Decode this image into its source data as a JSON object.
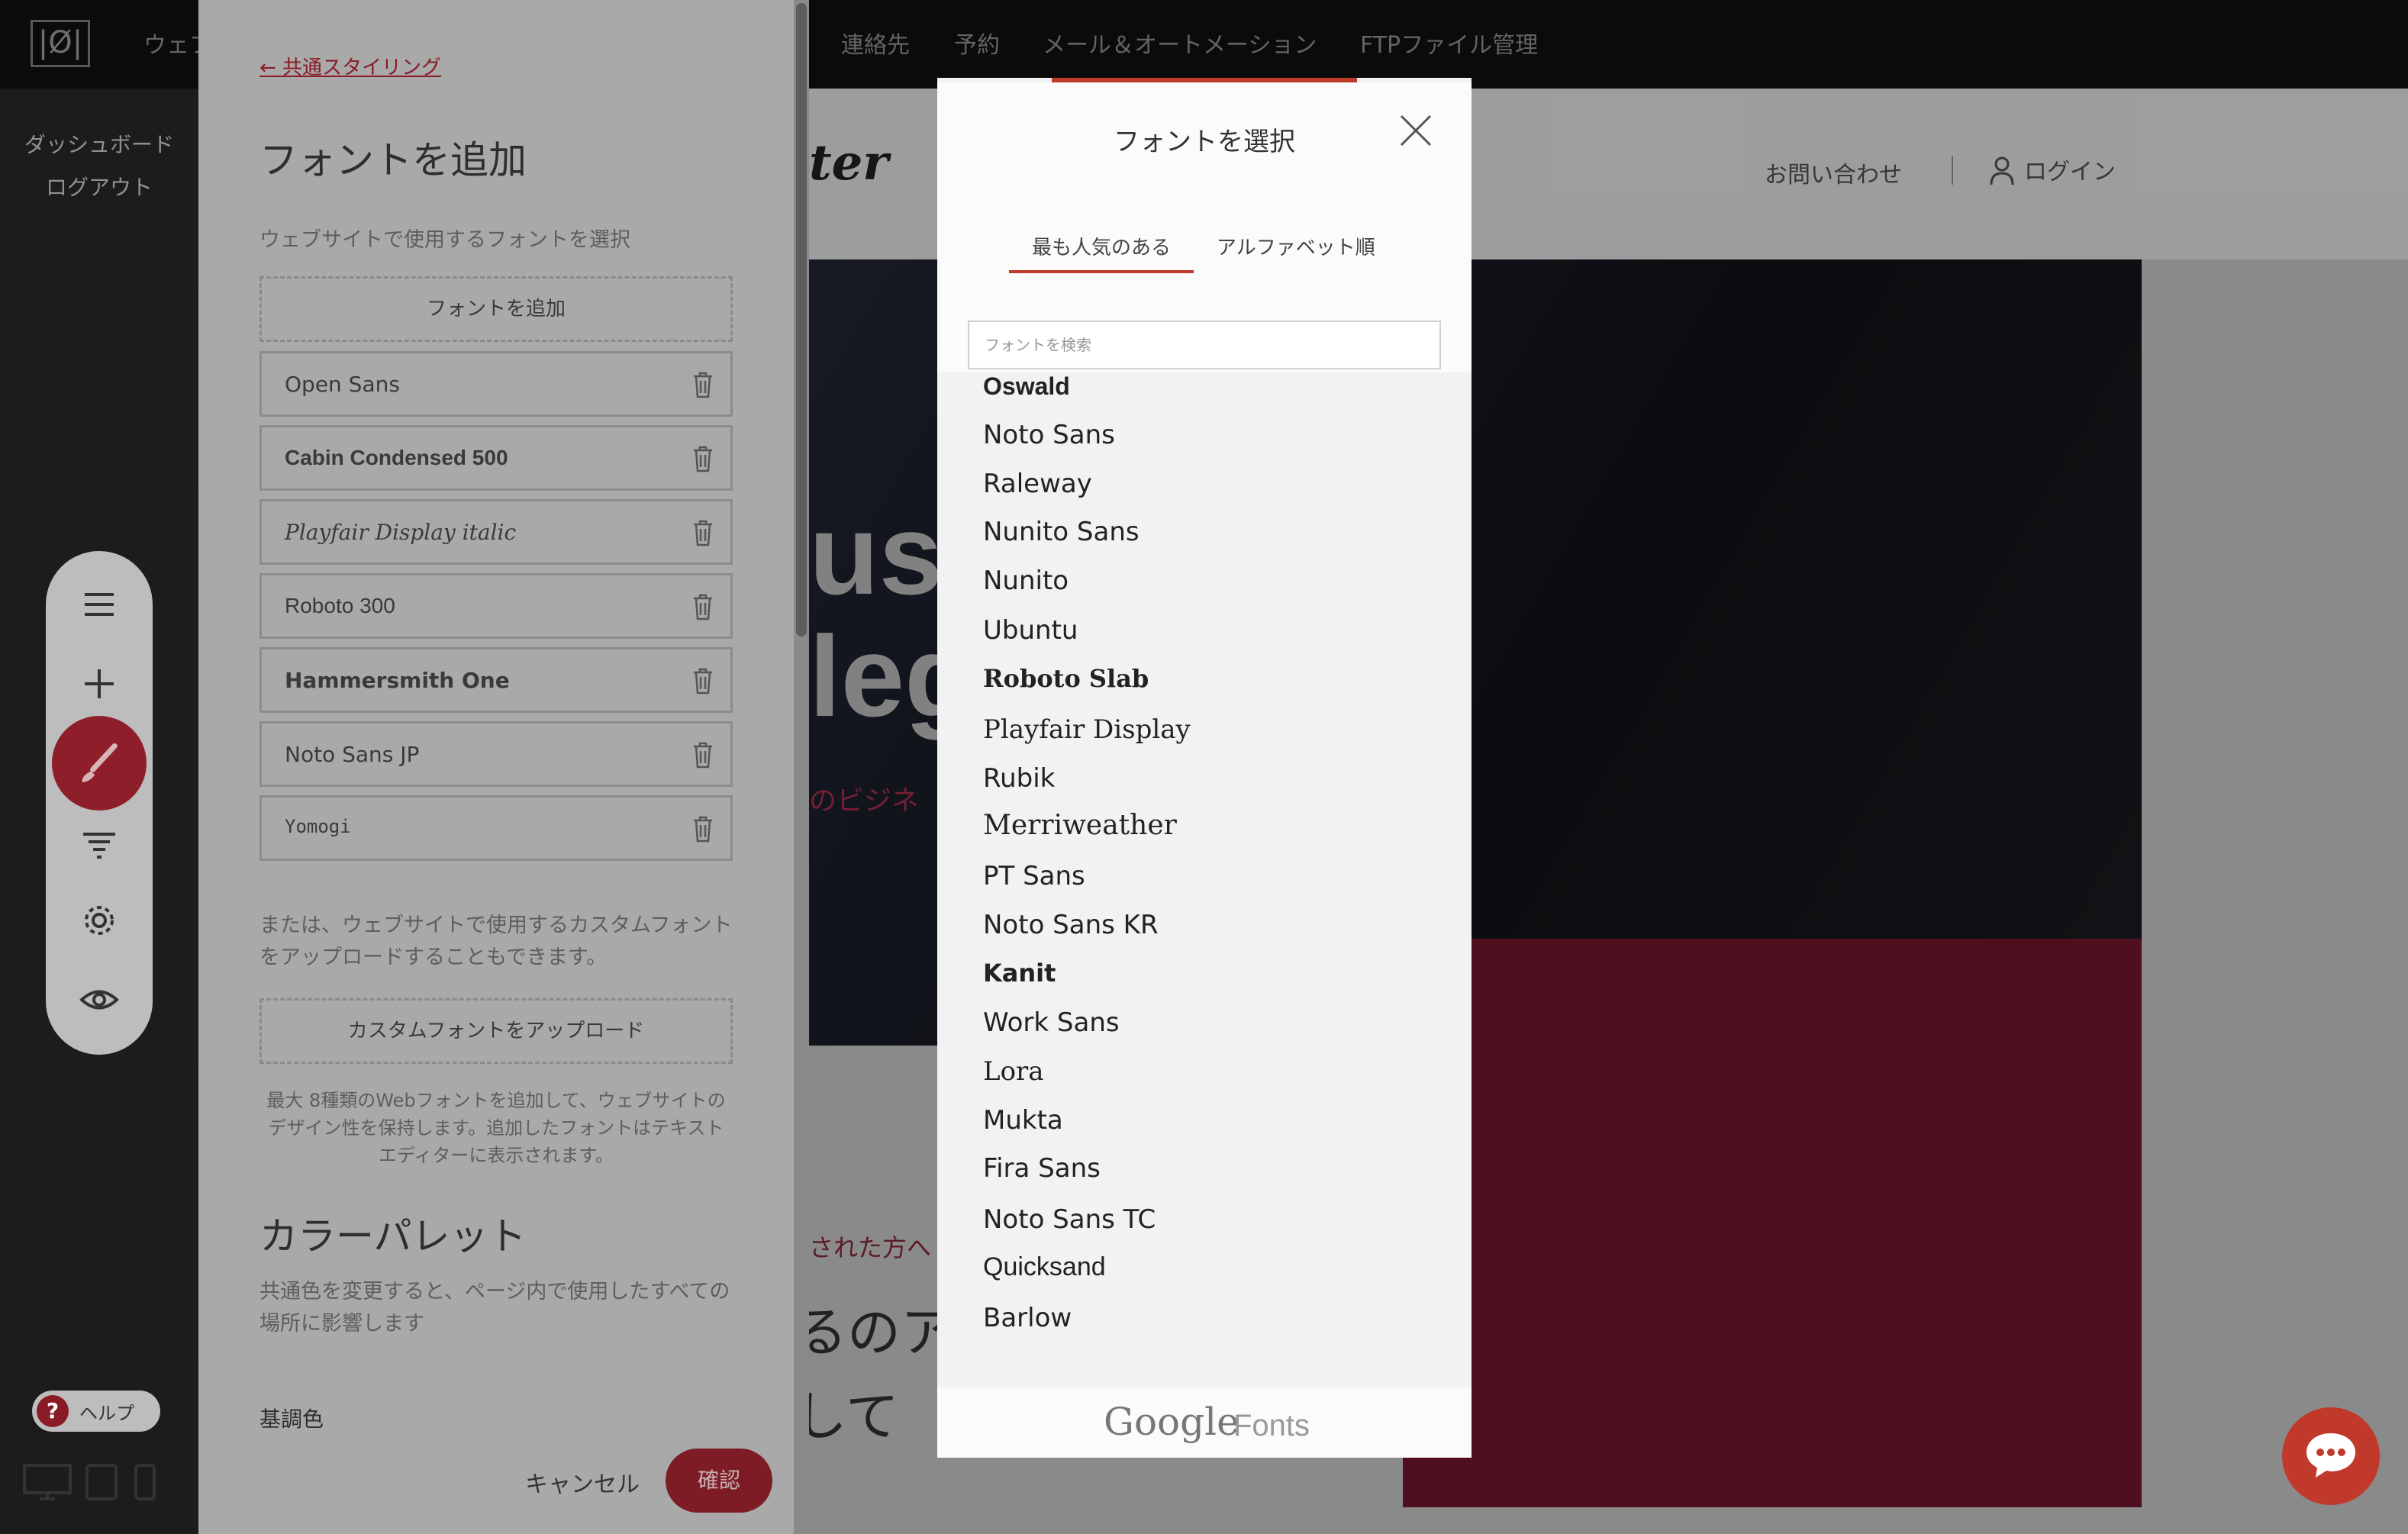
{
  "site": {
    "logo": "|Ø|",
    "nav": [
      "ウェブ",
      "連絡先",
      "予約",
      "メール＆オートメーション",
      "FTPファイル管理"
    ],
    "dashboard_link": "ダッシュボード",
    "logout_link": "ログアウト",
    "site_logo_fragment": "ter",
    "contact": "お問い合わせ",
    "login": "ログイン",
    "hero_line1": "usl",
    "hero_line2": "leg",
    "hero_sub": "のビジネ",
    "lower_text1": "された方へ",
    "lower_text2": "るのア",
    "lower_text3": "して"
  },
  "toolbar": {
    "items": [
      "menu-icon",
      "plus-icon",
      "brush-icon",
      "filter-icon",
      "gear-icon",
      "eye-icon"
    ],
    "help": "ヘルプ",
    "help_symbol": "?",
    "devices": [
      "desktop-icon",
      "tablet-icon",
      "mobile-icon"
    ]
  },
  "panel": {
    "back_link": "← 共通スタイリング",
    "title": "フォントを追加",
    "subtitle": "ウェブサイトで使用するフォントを選択",
    "add_font_button": "フォントを追加",
    "fonts": [
      "Open Sans",
      "Cabin Condensed 500",
      "Playfair Display italic",
      "Roboto 300",
      "Hammersmith One",
      "Noto Sans JP",
      "Yomogi"
    ],
    "custom_note": "または、ウェブサイトで使用するカスタムフォントをアップロードすることもできます。",
    "upload_button": "カスタムフォントをアップロード",
    "limit_note": "最大 8種類のWebフォントを追加して、ウェブサイトのデザイン性を保持します。追加したフォントはテキストエディターに表示されます。",
    "palette_title": "カラーパレット",
    "palette_note": "共通色を変更すると、ページ内で使用したすべての場所に影響します",
    "basic_color": "基調色",
    "cancel": "キャンセル",
    "confirm": "確認"
  },
  "modal": {
    "title": "フォントを選択",
    "tabs": [
      "最も人気のある",
      "アルファベット順"
    ],
    "active_tab": "最も人気のある",
    "search_placeholder": "フォントを検索",
    "search_value": "",
    "fonts": [
      "Oswald",
      "Noto Sans",
      "Raleway",
      "Nunito Sans",
      "Nunito",
      "Ubuntu",
      "Roboto Slab",
      "Playfair Display",
      "Rubik",
      "Merriweather",
      "PT Sans",
      "Noto Sans KR",
      "Kanit",
      "Work Sans",
      "Lora",
      "Mukta",
      "Fira Sans",
      "Noto Sans TC",
      "Quicksand",
      "Barlow"
    ],
    "footer_google": "Google",
    "footer_fonts": "Fonts"
  },
  "colors": {
    "accent": "#c0392b",
    "confirm_bg": "#7e1c26",
    "brush_bg": "#8e1e2a"
  }
}
